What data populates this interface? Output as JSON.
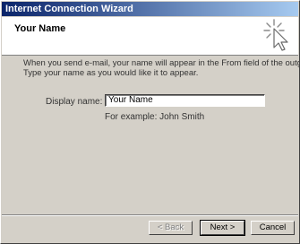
{
  "window": {
    "title": "Internet Connection Wizard"
  },
  "header": {
    "heading": "Your Name",
    "icon": "wizard-sparkle-icon"
  },
  "intro": {
    "line1": "When you send e-mail, your name will appear in the From field of the outgoing message.",
    "line2": "Type your name as you would like it to appear."
  },
  "form": {
    "display_name_label": "Display name:",
    "display_name_value": "Your Name",
    "example_text": "For example: John Smith"
  },
  "buttons": {
    "back": "< Back",
    "next": "Next >",
    "cancel": "Cancel"
  },
  "colors": {
    "titlebar_start": "#0a246a",
    "titlebar_end": "#a6caf0",
    "dialog_face": "#d4d0c8"
  }
}
